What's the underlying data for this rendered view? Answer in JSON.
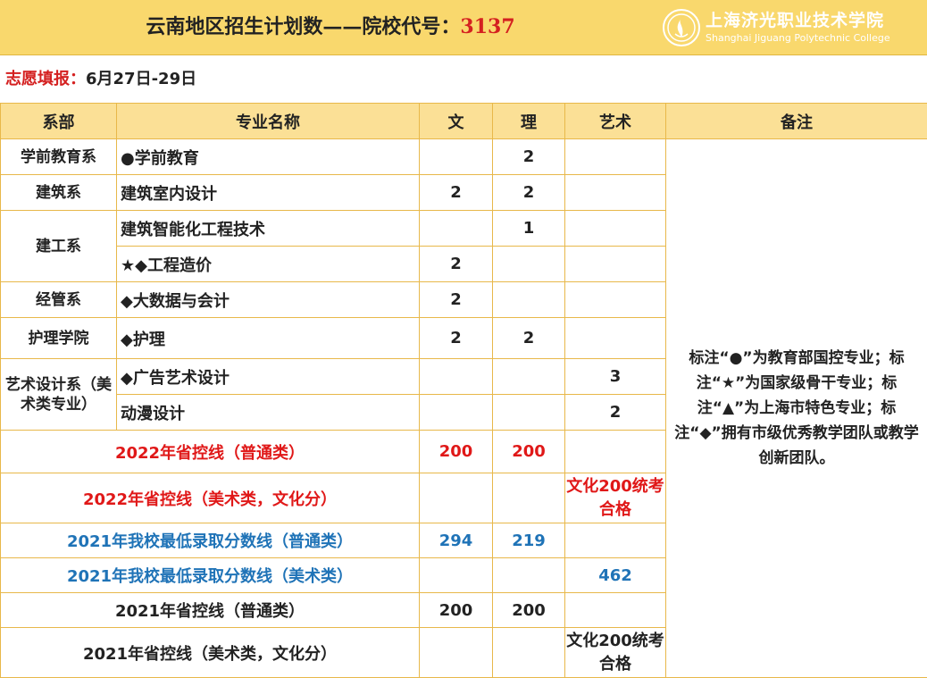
{
  "header": {
    "title_prefix": "云南地区招生计划数——院校代号：",
    "school_code": "3137",
    "school_name_cn": "上海济光职业技术学院",
    "school_name_en": "Shanghai Jiguang Polytechnic College"
  },
  "info": {
    "label": "志愿填报：",
    "dates": "6月27日-29日"
  },
  "table": {
    "headers": [
      "系部",
      "专业名称",
      "文",
      "理",
      "艺术",
      "备注"
    ],
    "departments": [
      "学前教育系",
      "建筑系",
      "建工系",
      "经管系",
      "护理学院",
      "艺术设计系（美术类专业）"
    ],
    "rows": [
      {
        "major": "●学前教育",
        "wen": "",
        "li": "2",
        "art": ""
      },
      {
        "major": "建筑室内设计",
        "wen": "2",
        "li": "2",
        "art": ""
      },
      {
        "major": "建筑智能化工程技术",
        "wen": "",
        "li": "1",
        "art": ""
      },
      {
        "major": "★◆工程造价",
        "wen": "2",
        "li": "",
        "art": ""
      },
      {
        "major": "◆大数据与会计",
        "wen": "2",
        "li": "",
        "art": ""
      },
      {
        "major": "◆护理",
        "wen": "2",
        "li": "2",
        "art": ""
      },
      {
        "major": "◆广告艺术设计",
        "wen": "",
        "li": "",
        "art": "3"
      },
      {
        "major": "动漫设计",
        "wen": "",
        "li": "",
        "art": "2"
      }
    ],
    "remark": "标注“●”为教育部国控专业；标注“★”为国家级骨干专业；标注“▲”为上海市特色专业；标注“◆”拥有市级优秀教学团队或教学创新团队。",
    "score_rows": [
      {
        "label": "2022年省控线（普通类）",
        "wen": "200",
        "li": "200",
        "art": ""
      },
      {
        "label": "2022年省控线（美术类，文化分）",
        "wen": "",
        "li": "",
        "art": "文化200统考合格"
      },
      {
        "label": "2021年我校最低录取分数线（普通类）",
        "wen": "294",
        "li": "219",
        "art": ""
      },
      {
        "label": "2021年我校最低录取分数线（美术类）",
        "wen": "",
        "li": "",
        "art": "462"
      },
      {
        "label": "2021年省控线（普通类）",
        "wen": "200",
        "li": "200",
        "art": ""
      },
      {
        "label": "2021年省控线（美术类，文化分）",
        "wen": "",
        "li": "",
        "art": "文化200统考合格"
      }
    ]
  },
  "colors": {
    "header_bg": "#f9d86d",
    "table_header_bg": "#fbe096",
    "border": "#e8b84a",
    "red": "#e01818",
    "blue": "#1f73b7"
  },
  "icons": {
    "logo": "school-emblem-icon"
  }
}
